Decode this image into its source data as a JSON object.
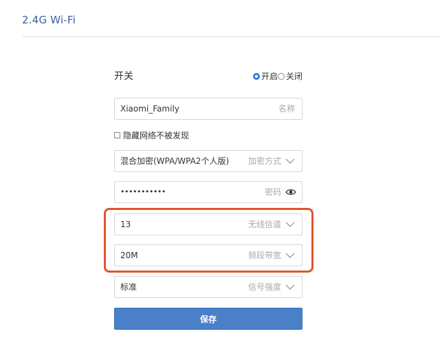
{
  "page": {
    "title": "2.4G Wi-Fi"
  },
  "switch": {
    "label": "开关",
    "on_label": "开启",
    "off_label": "关闭",
    "selected": "on"
  },
  "ssid": {
    "value": "Xiaomi_Family",
    "label": "名称"
  },
  "hide_network": {
    "label": "隐藏网络不被发现",
    "checked": false
  },
  "encryption": {
    "value": "混合加密(WPA/WPA2个人版)",
    "label": "加密方式"
  },
  "password": {
    "value": "•••••••••••",
    "label": "密码"
  },
  "channel": {
    "value": "13",
    "label": "无线信道"
  },
  "bandwidth": {
    "value": "20M",
    "label": "频段带宽"
  },
  "signal_strength": {
    "value": "标准",
    "label": "信号强度"
  },
  "actions": {
    "save_label": "保存"
  },
  "colors": {
    "accent": "#4a80c8",
    "title": "#3a5f9a",
    "highlight": "#e2532f"
  }
}
